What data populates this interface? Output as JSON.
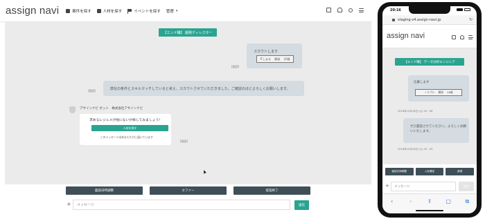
{
  "desktop": {
    "logo": "assign navi",
    "nav": [
      {
        "label": "案件を探す"
      },
      {
        "label": "人材を探す"
      },
      {
        "label": "イベントを探す"
      },
      {
        "label": "管理"
      }
    ],
    "nav_caret": "▾",
    "room_button": "【エンド職】 開発ディレクター",
    "bubble1_text": "スカウトします",
    "bubble1_inner": "ITしまる　 開発　 20歳",
    "bubble1_time": "[既読]",
    "bubble2_text": "弊社の条件とスキルマッチしていると考え、スカウトさせていただきました。ご確認のほどよろしくお願いします。",
    "bubble2_time": "[既読]",
    "bot_name": "アサインナビ ボット　株式会社アサインナビ",
    "bot_question": "求めるレジュメが他にないか探してみましょう！",
    "bot_button": "人材を探す",
    "bot_note": "このメッセージはあなただけに届いています",
    "bot_time": "[既読]",
    "actions": [
      "面談日時調整",
      "オファー",
      "提案終了"
    ],
    "message_placeholder": "メッセージ",
    "send_label": "送信",
    "plus": "+"
  },
  "mobile": {
    "time": "20:16",
    "url": "staging-v4.assign-navi.jp",
    "reload": "↻",
    "logo": "assign navi",
    "room_button": "【エンド職】 データ分析エンジニア",
    "bubble1_text": "応募します",
    "bubble1_inner": "ノエブル　 開発　 28歳",
    "bubble1_time": "2018年12月18日 (火) 20 : 08",
    "bubble2_text": "ぜひ面談させてください。よろしくお願いいたします。",
    "bubble2_time": "2018年12月18日 (火) 20 : 09",
    "actions": [
      "面談日時調整",
      "入社確定",
      "辞退"
    ],
    "message_placeholder": "メッセージ",
    "send_label": "送信",
    "plus": "+",
    "toolbar": [
      "‹",
      "›",
      "⇪",
      "▢",
      "⧉"
    ]
  },
  "colors": {
    "accent": "#2aa490",
    "dark_button": "#3e4f58",
    "chat_bg": "#ebebeb",
    "bubble": "#d4dbe1"
  }
}
